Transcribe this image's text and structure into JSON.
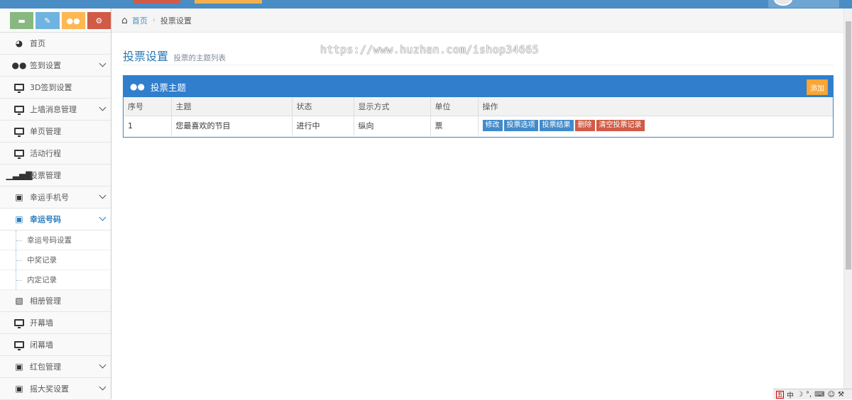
{
  "shortcuts": [
    {
      "name": "chat",
      "icon": "comment-icon",
      "color": "#87b87f"
    },
    {
      "name": "edit",
      "icon": "pencil-icon",
      "color": "#6fb3e0"
    },
    {
      "name": "users",
      "icon": "users-icon",
      "color": "#ffb752"
    },
    {
      "name": "settings",
      "icon": "cogs-icon",
      "color": "#d15b47"
    }
  ],
  "sidebar": {
    "items": [
      {
        "label": "首页",
        "icon": "dashboard-icon"
      },
      {
        "label": "签到设置",
        "icon": "users-icon"
      },
      {
        "label": "3D签到设置",
        "icon": "desktop-icon"
      },
      {
        "label": "上墙消息管理",
        "icon": "desktop-icon"
      },
      {
        "label": "单页管理",
        "icon": "desktop-icon"
      },
      {
        "label": "活动行程",
        "icon": "desktop-icon"
      },
      {
        "label": "投票管理",
        "icon": "signal-icon"
      },
      {
        "label": "幸运手机号",
        "icon": "gift-icon"
      },
      {
        "label": "幸运号码",
        "icon": "gift-icon"
      },
      {
        "label": "相册管理",
        "icon": "picture-icon"
      },
      {
        "label": "开幕墙",
        "icon": "desktop-icon"
      },
      {
        "label": "闭幕墙",
        "icon": "desktop-icon"
      },
      {
        "label": "红包管理",
        "icon": "gift-icon"
      },
      {
        "label": "摇大奖设置",
        "icon": "gift-icon"
      }
    ],
    "subitems": [
      "幸运号码设置",
      "中奖记录",
      "内定记录"
    ]
  },
  "breadcrumb": {
    "home": "首页",
    "current": "投票设置"
  },
  "header": {
    "title": "投票设置",
    "subtitle": "投票的主题列表"
  },
  "watermark": "https://www.huzhan.com/ishop34665",
  "widget": {
    "title": "投票主题",
    "add_label": "添加",
    "columns": [
      "序号",
      "主题",
      "状态",
      "显示方式",
      "单位",
      "操作"
    ],
    "rows": [
      {
        "id": "1",
        "topic": "您最喜欢的节目",
        "status": "进行中",
        "display": "纵向",
        "unit": "票"
      }
    ],
    "actions": [
      "修改",
      "投票选项",
      "投票结果",
      "删除",
      "清空投票记录"
    ]
  },
  "ime": {
    "mode": "中"
  },
  "colors": {
    "accent": "#307ecc",
    "danger": "#d15b47",
    "warning": "#f9a636",
    "primary_btn": "#428bca"
  }
}
